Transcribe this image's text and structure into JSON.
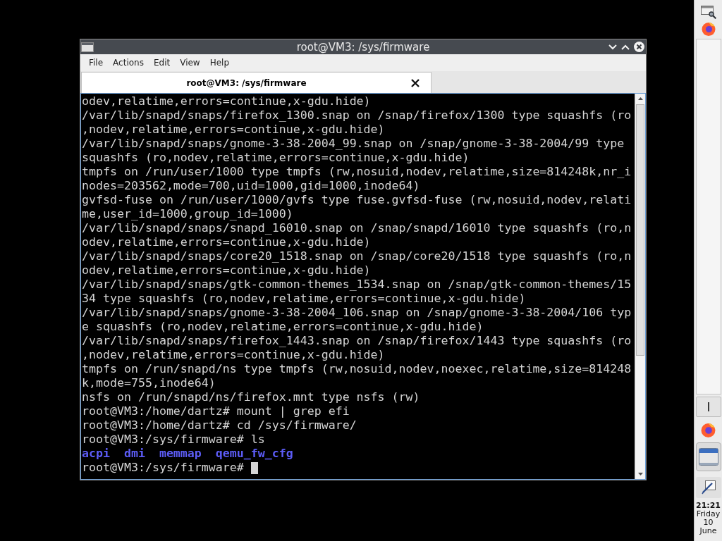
{
  "window": {
    "title": "root@VM3: /sys/firmware",
    "menu": [
      "File",
      "Actions",
      "Edit",
      "View",
      "Help"
    ],
    "tabs": [
      {
        "label": "root@VM3: /sys/firmware",
        "selected": true
      }
    ]
  },
  "terminal": {
    "rows": [
      {
        "kind": "output",
        "text": "odev,relatime,errors=continue,x-gdu.hide)"
      },
      {
        "kind": "output",
        "text": "/var/lib/snapd/snaps/firefox_1300.snap on /snap/firefox/1300 type squashfs (ro"
      },
      {
        "kind": "output",
        "text": ",nodev,relatime,errors=continue,x-gdu.hide)"
      },
      {
        "kind": "output",
        "text": "/var/lib/snapd/snaps/gnome-3-38-2004_99.snap on /snap/gnome-3-38-2004/99 type"
      },
      {
        "kind": "output",
        "text": "squashfs (ro,nodev,relatime,errors=continue,x-gdu.hide)"
      },
      {
        "kind": "output",
        "text": "tmpfs on /run/user/1000 type tmpfs (rw,nosuid,nodev,relatime,size=814248k,nr_i"
      },
      {
        "kind": "output",
        "text": "nodes=203562,mode=700,uid=1000,gid=1000,inode64)"
      },
      {
        "kind": "output",
        "text": "gvfsd-fuse on /run/user/1000/gvfs type fuse.gvfsd-fuse (rw,nosuid,nodev,relati"
      },
      {
        "kind": "output",
        "text": "me,user_id=1000,group_id=1000)"
      },
      {
        "kind": "output",
        "text": "/var/lib/snapd/snaps/snapd_16010.snap on /snap/snapd/16010 type squashfs (ro,n"
      },
      {
        "kind": "output",
        "text": "odev,relatime,errors=continue,x-gdu.hide)"
      },
      {
        "kind": "output",
        "text": "/var/lib/snapd/snaps/core20_1518.snap on /snap/core20/1518 type squashfs (ro,n"
      },
      {
        "kind": "output",
        "text": "odev,relatime,errors=continue,x-gdu.hide)"
      },
      {
        "kind": "output",
        "text": "/var/lib/snapd/snaps/gtk-common-themes_1534.snap on /snap/gtk-common-themes/15"
      },
      {
        "kind": "output",
        "text": "34 type squashfs (ro,nodev,relatime,errors=continue,x-gdu.hide)"
      },
      {
        "kind": "output",
        "text": "/var/lib/snapd/snaps/gnome-3-38-2004_106.snap on /snap/gnome-3-38-2004/106 typ"
      },
      {
        "kind": "output",
        "text": "e squashfs (ro,nodev,relatime,errors=continue,x-gdu.hide)"
      },
      {
        "kind": "output",
        "text": "/var/lib/snapd/snaps/firefox_1443.snap on /snap/firefox/1443 type squashfs (ro"
      },
      {
        "kind": "output",
        "text": ",nodev,relatime,errors=continue,x-gdu.hide)"
      },
      {
        "kind": "output",
        "text": "tmpfs on /run/snapd/ns type tmpfs (rw,nosuid,nodev,noexec,relatime,size=814248"
      },
      {
        "kind": "output",
        "text": "k,mode=755,inode64)"
      },
      {
        "kind": "output",
        "text": "nsfs on /run/snapd/ns/firefox.mnt type nsfs (rw)"
      },
      {
        "kind": "command",
        "text": "root@VM3:/home/dartz# mount | grep efi"
      },
      {
        "kind": "command",
        "text": "root@VM3:/home/dartz# cd /sys/firmware/"
      },
      {
        "kind": "command",
        "text": "root@VM3:/sys/firmware# ls"
      },
      {
        "kind": "listing",
        "entries": [
          "acpi",
          "dmi",
          "memmap",
          "qemu_fw_cfg"
        ]
      },
      {
        "kind": "prompt",
        "text": "root@VM3:/sys/firmware#",
        "cursor": true
      }
    ]
  },
  "panel": {
    "clock": {
      "time": "21:21",
      "day": "Friday",
      "date": "10",
      "month": "June"
    }
  }
}
